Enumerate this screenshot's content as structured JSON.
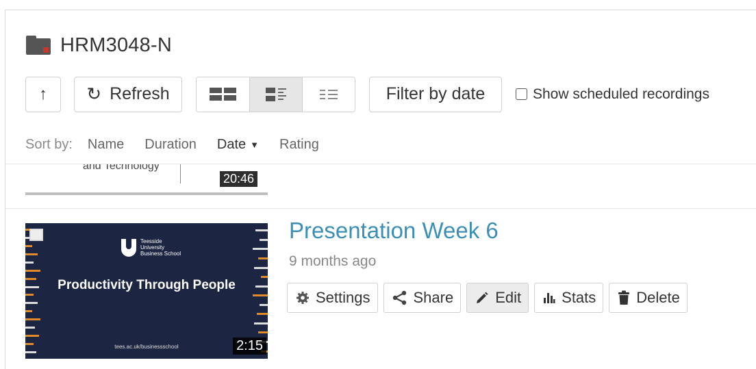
{
  "folder": {
    "name": "HRM3048-N"
  },
  "toolbar": {
    "up_icon": "arrow-up-icon",
    "refresh_label": "Refresh",
    "filter_label": "Filter by date",
    "show_scheduled_label": "Show scheduled recordings",
    "show_scheduled_checked": false,
    "view_modes": [
      "thumbnails",
      "details",
      "list"
    ],
    "active_view": "details"
  },
  "sort": {
    "label": "Sort by:",
    "options": [
      "Name",
      "Duration",
      "Date",
      "Rating"
    ],
    "active": "Date",
    "direction": "descending"
  },
  "recordings": [
    {
      "thumbnail_text": "and Technology",
      "duration": "20:46"
    },
    {
      "title": "Presentation Week 6",
      "age": "9 months ago",
      "duration": "2:15",
      "thumbnail": {
        "title": "Productivity Through People",
        "brand": "Teesside University Business School",
        "url": "tees.ac.uk/businessschool"
      },
      "actions": [
        "Settings",
        "Share",
        "Edit",
        "Stats",
        "Delete"
      ],
      "active_action": "Edit"
    }
  ],
  "colors": {
    "accent_link": "#3a8fb7",
    "folder_icon": "#555555",
    "folder_marker": "#c0392b",
    "thumb_bg": "#1c2541",
    "thumb_orange": "#e08a2c"
  }
}
